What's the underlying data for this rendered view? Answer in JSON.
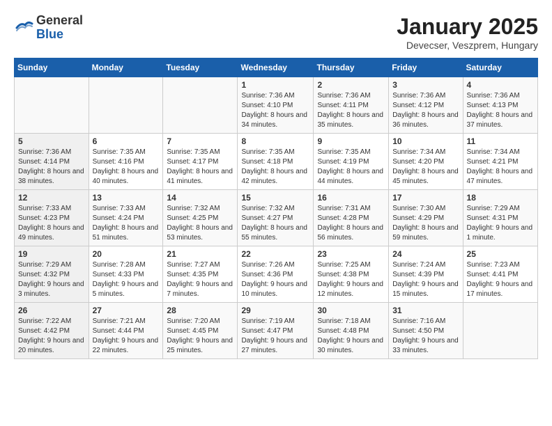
{
  "header": {
    "logo_general": "General",
    "logo_blue": "Blue",
    "month_title": "January 2025",
    "location": "Devecser, Veszprem, Hungary"
  },
  "days_of_week": [
    "Sunday",
    "Monday",
    "Tuesday",
    "Wednesday",
    "Thursday",
    "Friday",
    "Saturday"
  ],
  "weeks": [
    [
      {
        "day": "",
        "info": ""
      },
      {
        "day": "",
        "info": ""
      },
      {
        "day": "",
        "info": ""
      },
      {
        "day": "1",
        "info": "Sunrise: 7:36 AM\nSunset: 4:10 PM\nDaylight: 8 hours and 34 minutes."
      },
      {
        "day": "2",
        "info": "Sunrise: 7:36 AM\nSunset: 4:11 PM\nDaylight: 8 hours and 35 minutes."
      },
      {
        "day": "3",
        "info": "Sunrise: 7:36 AM\nSunset: 4:12 PM\nDaylight: 8 hours and 36 minutes."
      },
      {
        "day": "4",
        "info": "Sunrise: 7:36 AM\nSunset: 4:13 PM\nDaylight: 8 hours and 37 minutes."
      }
    ],
    [
      {
        "day": "5",
        "info": "Sunrise: 7:36 AM\nSunset: 4:14 PM\nDaylight: 8 hours and 38 minutes."
      },
      {
        "day": "6",
        "info": "Sunrise: 7:35 AM\nSunset: 4:16 PM\nDaylight: 8 hours and 40 minutes."
      },
      {
        "day": "7",
        "info": "Sunrise: 7:35 AM\nSunset: 4:17 PM\nDaylight: 8 hours and 41 minutes."
      },
      {
        "day": "8",
        "info": "Sunrise: 7:35 AM\nSunset: 4:18 PM\nDaylight: 8 hours and 42 minutes."
      },
      {
        "day": "9",
        "info": "Sunrise: 7:35 AM\nSunset: 4:19 PM\nDaylight: 8 hours and 44 minutes."
      },
      {
        "day": "10",
        "info": "Sunrise: 7:34 AM\nSunset: 4:20 PM\nDaylight: 8 hours and 45 minutes."
      },
      {
        "day": "11",
        "info": "Sunrise: 7:34 AM\nSunset: 4:21 PM\nDaylight: 8 hours and 47 minutes."
      }
    ],
    [
      {
        "day": "12",
        "info": "Sunrise: 7:33 AM\nSunset: 4:23 PM\nDaylight: 8 hours and 49 minutes."
      },
      {
        "day": "13",
        "info": "Sunrise: 7:33 AM\nSunset: 4:24 PM\nDaylight: 8 hours and 51 minutes."
      },
      {
        "day": "14",
        "info": "Sunrise: 7:32 AM\nSunset: 4:25 PM\nDaylight: 8 hours and 53 minutes."
      },
      {
        "day": "15",
        "info": "Sunrise: 7:32 AM\nSunset: 4:27 PM\nDaylight: 8 hours and 55 minutes."
      },
      {
        "day": "16",
        "info": "Sunrise: 7:31 AM\nSunset: 4:28 PM\nDaylight: 8 hours and 56 minutes."
      },
      {
        "day": "17",
        "info": "Sunrise: 7:30 AM\nSunset: 4:29 PM\nDaylight: 8 hours and 59 minutes."
      },
      {
        "day": "18",
        "info": "Sunrise: 7:29 AM\nSunset: 4:31 PM\nDaylight: 9 hours and 1 minute."
      }
    ],
    [
      {
        "day": "19",
        "info": "Sunrise: 7:29 AM\nSunset: 4:32 PM\nDaylight: 9 hours and 3 minutes."
      },
      {
        "day": "20",
        "info": "Sunrise: 7:28 AM\nSunset: 4:33 PM\nDaylight: 9 hours and 5 minutes."
      },
      {
        "day": "21",
        "info": "Sunrise: 7:27 AM\nSunset: 4:35 PM\nDaylight: 9 hours and 7 minutes."
      },
      {
        "day": "22",
        "info": "Sunrise: 7:26 AM\nSunset: 4:36 PM\nDaylight: 9 hours and 10 minutes."
      },
      {
        "day": "23",
        "info": "Sunrise: 7:25 AM\nSunset: 4:38 PM\nDaylight: 9 hours and 12 minutes."
      },
      {
        "day": "24",
        "info": "Sunrise: 7:24 AM\nSunset: 4:39 PM\nDaylight: 9 hours and 15 minutes."
      },
      {
        "day": "25",
        "info": "Sunrise: 7:23 AM\nSunset: 4:41 PM\nDaylight: 9 hours and 17 minutes."
      }
    ],
    [
      {
        "day": "26",
        "info": "Sunrise: 7:22 AM\nSunset: 4:42 PM\nDaylight: 9 hours and 20 minutes."
      },
      {
        "day": "27",
        "info": "Sunrise: 7:21 AM\nSunset: 4:44 PM\nDaylight: 9 hours and 22 minutes."
      },
      {
        "day": "28",
        "info": "Sunrise: 7:20 AM\nSunset: 4:45 PM\nDaylight: 9 hours and 25 minutes."
      },
      {
        "day": "29",
        "info": "Sunrise: 7:19 AM\nSunset: 4:47 PM\nDaylight: 9 hours and 27 minutes."
      },
      {
        "day": "30",
        "info": "Sunrise: 7:18 AM\nSunset: 4:48 PM\nDaylight: 9 hours and 30 minutes."
      },
      {
        "day": "31",
        "info": "Sunrise: 7:16 AM\nSunset: 4:50 PM\nDaylight: 9 hours and 33 minutes."
      },
      {
        "day": "",
        "info": ""
      }
    ]
  ]
}
